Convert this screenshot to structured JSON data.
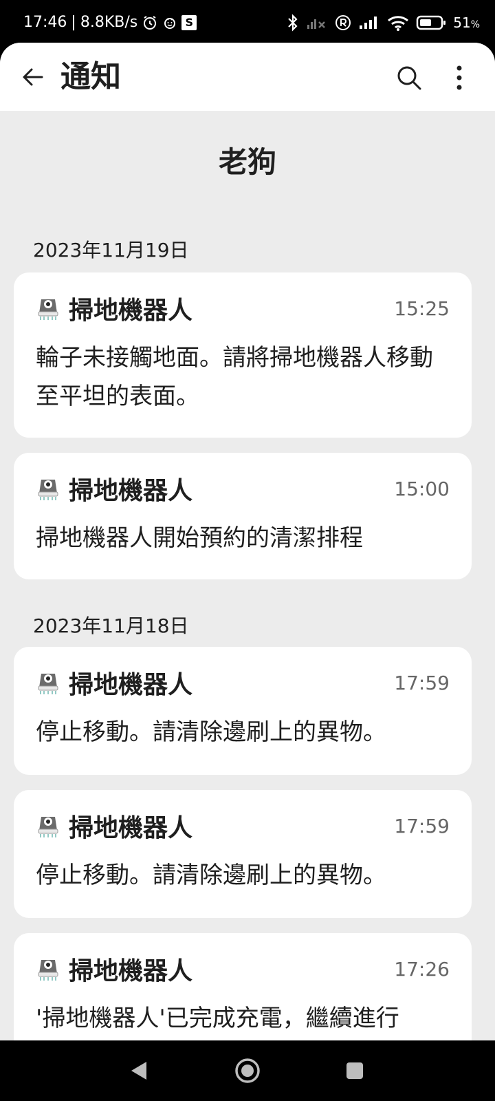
{
  "status_bar": {
    "time": "17:46",
    "net_speed": "8.8KB/s",
    "s_badge": "S",
    "battery_pct": "51",
    "battery_unit": "%"
  },
  "app_bar": {
    "title": "通知"
  },
  "device_name": "老狗",
  "groups": [
    {
      "date": "2023年11月19日",
      "items": [
        {
          "app": "掃地機器人",
          "time": "15:25",
          "message": "輪子未接觸地面。請將掃地機器人移動至平坦的表面。"
        },
        {
          "app": "掃地機器人",
          "time": "15:00",
          "message": "掃地機器人開始預約的清潔排程"
        }
      ]
    },
    {
      "date": "2023年11月18日",
      "items": [
        {
          "app": "掃地機器人",
          "time": "17:59",
          "message": "停止移動。請清除邊刷上的異物。"
        },
        {
          "app": "掃地機器人",
          "time": "17:59",
          "message": "停止移動。請清除邊刷上的異物。"
        },
        {
          "app": "掃地機器人",
          "time": "17:26",
          "message": "'掃地機器人'已完成充電，繼續進行"
        }
      ]
    }
  ],
  "icons": {
    "back": "arrow-left-icon",
    "search": "search-icon",
    "more": "more-vert-icon",
    "robot": "robot-vacuum-icon",
    "nav_back": "triangle-back-icon",
    "nav_home": "circle-home-icon",
    "nav_recents": "square-recents-icon"
  },
  "colors": {
    "background": "#ececec",
    "card": "#ffffff",
    "text": "#1f1f1f",
    "muted": "#666666"
  }
}
